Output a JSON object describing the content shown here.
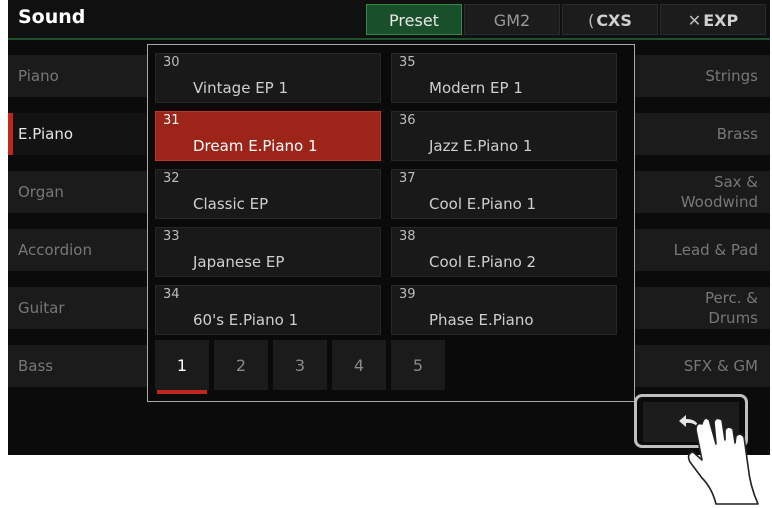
{
  "header": {
    "title": "Sound",
    "tabs": [
      {
        "label": "Preset",
        "active": true
      },
      {
        "label": "GM2",
        "active": false
      },
      {
        "label": "CXS",
        "active": false
      },
      {
        "label": "EXP",
        "active": false
      }
    ]
  },
  "left_categories": [
    "Piano",
    "E.Piano",
    "Organ",
    "Accordion",
    "Guitar",
    "Bass"
  ],
  "right_categories": [
    "Strings",
    "Brass",
    "Sax & Woodwind",
    "Lead & Pad",
    "Perc. & Drums",
    "SFX & GM"
  ],
  "selected_category": "E.Piano",
  "voices": [
    {
      "number": "30",
      "name": "Vintage EP 1"
    },
    {
      "number": "31",
      "name": "Dream E.Piano 1"
    },
    {
      "number": "32",
      "name": "Classic EP"
    },
    {
      "number": "33",
      "name": "Japanese EP"
    },
    {
      "number": "34",
      "name": "60's E.Piano 1"
    },
    {
      "number": "35",
      "name": "Modern EP 1"
    },
    {
      "number": "36",
      "name": "Jazz E.Piano 1"
    },
    {
      "number": "37",
      "name": "Cool E.Piano 1"
    },
    {
      "number": "38",
      "name": "Cool E.Piano 2"
    },
    {
      "number": "39",
      "name": "Phase E.Piano"
    }
  ],
  "selected_voice": "31",
  "pages": [
    "1",
    "2",
    "3",
    "4",
    "5"
  ],
  "current_page": "1",
  "colors": {
    "accent": "#c0271c",
    "preset_tab": "#1a4f2b",
    "selected_voice": "#9c2419"
  },
  "icons": {
    "back": "back-arrow-icon",
    "hand": "pointing-hand-icon"
  }
}
